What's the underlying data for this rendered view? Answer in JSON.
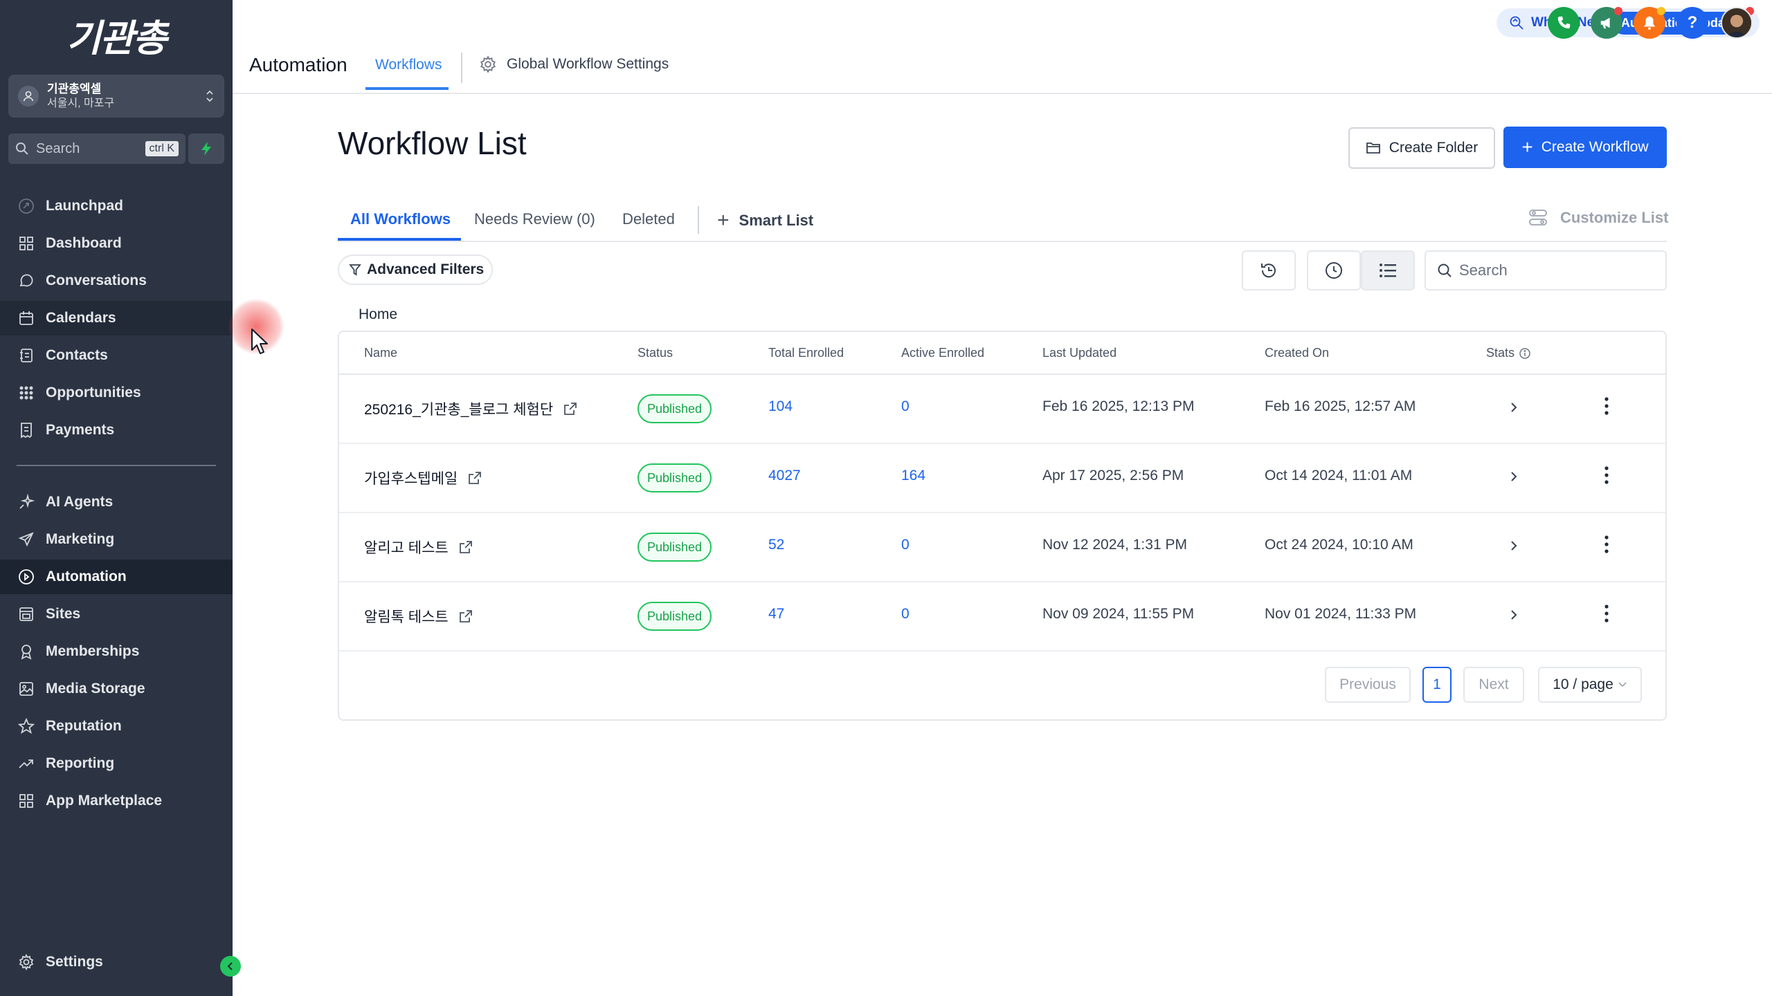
{
  "sidebar": {
    "logo": "기관총",
    "account": {
      "name": "기관총엑셀",
      "location": "서울시, 마포구"
    },
    "search": {
      "placeholder": "Search",
      "shortcut": "ctrl K"
    },
    "items": [
      {
        "label": "Launchpad",
        "icon": "launchpad-icon"
      },
      {
        "label": "Dashboard",
        "icon": "dashboard-icon"
      },
      {
        "label": "Conversations",
        "icon": "chat-bubble-icon"
      },
      {
        "label": "Calendars",
        "icon": "calendar-icon"
      },
      {
        "label": "Contacts",
        "icon": "contacts-icon"
      },
      {
        "label": "Opportunities",
        "icon": "opportunities-icon"
      },
      {
        "label": "Payments",
        "icon": "payments-icon"
      },
      {
        "label": "AI Agents",
        "icon": "sparkle-icon"
      },
      {
        "label": "Marketing",
        "icon": "send-icon"
      },
      {
        "label": "Automation",
        "icon": "automation-icon"
      },
      {
        "label": "Sites",
        "icon": "sites-icon"
      },
      {
        "label": "Memberships",
        "icon": "membership-icon"
      },
      {
        "label": "Media Storage",
        "icon": "image-icon"
      },
      {
        "label": "Reputation",
        "icon": "star-icon"
      },
      {
        "label": "Reporting",
        "icon": "trend-icon"
      },
      {
        "label": "App Marketplace",
        "icon": "grid-icon"
      }
    ],
    "settings_label": "Settings",
    "active_item": "Automation",
    "hover_item": "Calendars"
  },
  "header": {
    "title": "Automation",
    "tabs": [
      {
        "label": "Workflows",
        "active": true
      },
      {
        "label": "Global Workflow Settings",
        "active": false
      }
    ],
    "whats_new_label": "What's New",
    "updates_pill": "Automation Updates",
    "accent_color": "#1d63ed"
  },
  "main": {
    "title": "Workflow List",
    "create_folder_label": "Create Folder",
    "create_workflow_label": "Create Workflow",
    "subtabs": [
      {
        "label": "All Workflows",
        "active": true
      },
      {
        "label": "Needs Review (0)",
        "active": false
      },
      {
        "label": "Deleted",
        "active": false
      }
    ],
    "smart_list_label": "Smart List",
    "customize_label": "Customize List",
    "advanced_filters_label": "Advanced Filters",
    "search_placeholder": "Search",
    "breadcrumb": "Home"
  },
  "table": {
    "columns": [
      "Name",
      "Status",
      "Total Enrolled",
      "Active Enrolled",
      "Last Updated",
      "Created On",
      "Stats"
    ],
    "rows": [
      {
        "name": "250216_기관총_블로그 체험단",
        "status": "Published",
        "total": "104",
        "active": "0",
        "updated": "Feb 16 2025, 12:13 PM",
        "created": "Feb 16 2025, 12:57 AM"
      },
      {
        "name": "가입후스텝메일",
        "status": "Published",
        "total": "4027",
        "active": "164",
        "updated": "Apr 17 2025, 2:56 PM",
        "created": "Oct 14 2024, 11:01 AM"
      },
      {
        "name": "알리고 테스트",
        "status": "Published",
        "total": "52",
        "active": "0",
        "updated": "Nov 12 2024, 1:31 PM",
        "created": "Oct 24 2024, 10:10 AM"
      },
      {
        "name": "알림톡 테스트",
        "status": "Published",
        "total": "47",
        "active": "0",
        "updated": "Nov 09 2024, 11:55 PM",
        "created": "Nov 01 2024, 11:33 PM"
      }
    ]
  },
  "pagination": {
    "previous_label": "Previous",
    "current_page": "1",
    "next_label": "Next",
    "per_page_label": "10 / page"
  }
}
